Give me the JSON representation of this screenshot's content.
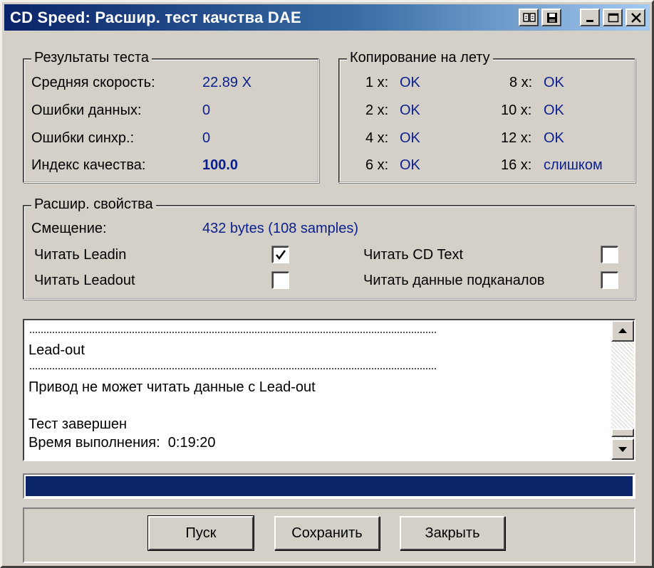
{
  "window": {
    "title": "CD Speed: Расшир. тест качства DAE",
    "title_bar_colors": [
      "#0a246a",
      "#a6caf0"
    ]
  },
  "title_buttons": [
    {
      "name": "book-icon"
    },
    {
      "name": "save-disk-icon"
    },
    {
      "name": "minimize-icon"
    },
    {
      "name": "maximize-icon"
    },
    {
      "name": "close-icon"
    }
  ],
  "results": {
    "legend": "Результаты теста",
    "rows": [
      {
        "label": "Средняя скорость:",
        "value": "22.89 X"
      },
      {
        "label": "Ошибки данных:",
        "value": "0"
      },
      {
        "label": "Ошибки синхр.:",
        "value": "0"
      },
      {
        "label": "Индекс качества:",
        "value": "100.0"
      }
    ]
  },
  "onthefly": {
    "legend": "Копирование на лету",
    "left": [
      {
        "label": "1 x:",
        "value": "OK"
      },
      {
        "label": "2 x:",
        "value": "OK"
      },
      {
        "label": "4 x:",
        "value": "OK"
      },
      {
        "label": "6 x:",
        "value": "OK"
      }
    ],
    "right": [
      {
        "label": "8 x:",
        "value": "OK"
      },
      {
        "label": "10 x:",
        "value": "OK"
      },
      {
        "label": "12 x:",
        "value": "OK"
      },
      {
        "label": "16 x:",
        "value": "слишком"
      }
    ]
  },
  "advanced": {
    "legend": "Расшир. свойства",
    "offset_label": "Смещение:",
    "offset_value": "432 bytes (108 samples)",
    "read_leadin": {
      "label": "Читать Leadin",
      "checked": true
    },
    "read_leadout": {
      "label": "Читать Leadout",
      "checked": false
    },
    "read_cdtext": {
      "label": "Читать CD Text",
      "checked": false
    },
    "read_subchannel": {
      "label": "Читать данные подканалов",
      "checked": false
    }
  },
  "log": {
    "lines": [
      "Lead-out",
      "Привод не может читать данные с Lead-out",
      "Тест завершен",
      "Время выполнения:  0:19:20"
    ]
  },
  "progress": {
    "fraction": 1.0,
    "color": "#0a246a"
  },
  "buttons": {
    "start": "Пуск",
    "save": "Сохранить",
    "close": "Закрыть"
  }
}
